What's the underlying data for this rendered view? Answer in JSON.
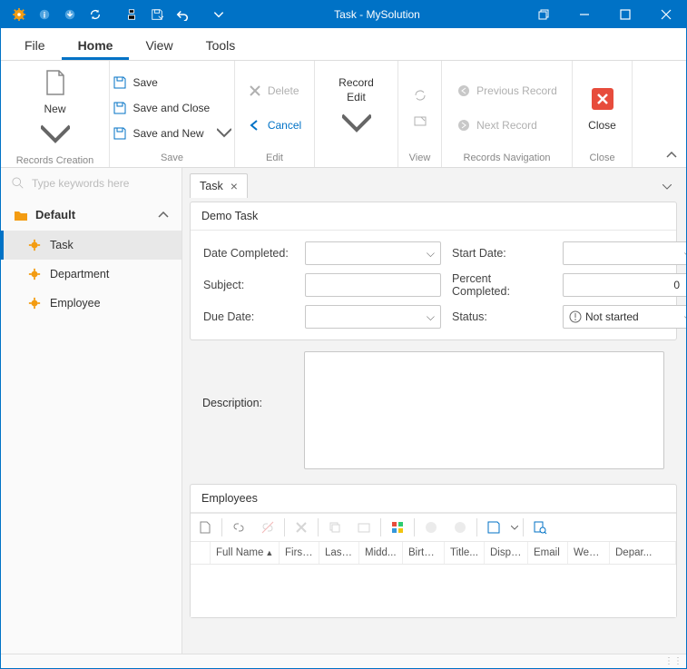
{
  "window": {
    "title": "Task - MySolution"
  },
  "menu": {
    "tabs": [
      "File",
      "Home",
      "View",
      "Tools"
    ],
    "active": "Home"
  },
  "ribbon": {
    "new": "New",
    "save": "Save",
    "saveClose": "Save and Close",
    "saveNew": "Save and New",
    "delete": "Delete",
    "cancel": "Cancel",
    "recordEdit": "Record\nEdit",
    "prevRecord": "Previous Record",
    "nextRecord": "Next Record",
    "close": "Close",
    "groups": {
      "recordsCreation": "Records Creation",
      "save": "Save",
      "edit": "Edit",
      "view": "View",
      "nav": "Records Navigation",
      "close": "Close"
    }
  },
  "search": {
    "placeholder": "Type keywords here"
  },
  "nav": {
    "group": "Default",
    "items": [
      "Task",
      "Department",
      "Employee"
    ],
    "selected": "Task"
  },
  "tab": {
    "label": "Task"
  },
  "form": {
    "header": "Demo Task",
    "labels": {
      "dateCompleted": "Date Completed:",
      "subject": "Subject:",
      "dueDate": "Due Date:",
      "startDate": "Start Date:",
      "percentCompleted": "Percent Completed:",
      "status": "Status:",
      "description": "Description:"
    },
    "values": {
      "dateCompleted": "",
      "subject": "",
      "dueDate": "",
      "startDate": "",
      "percentCompleted": "0",
      "status": "Not started",
      "description": ""
    }
  },
  "employees": {
    "header": "Employees",
    "columns": [
      "",
      "Full Name",
      "First...",
      "Last...",
      "Midd...",
      "Birth...",
      "Title...",
      "Displ...",
      "Email",
      "Web...",
      "Depar..."
    ]
  }
}
